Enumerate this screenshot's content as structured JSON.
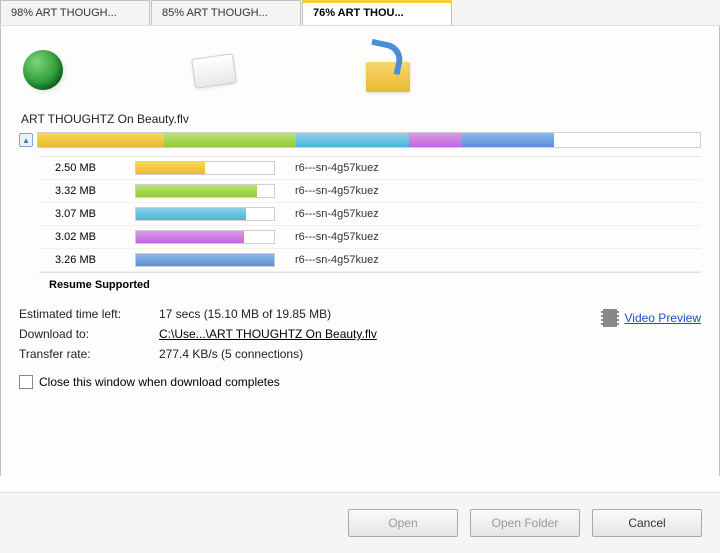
{
  "tabs": [
    {
      "label": "98% ART THOUGH..."
    },
    {
      "label": "85% ART THOUGH..."
    },
    {
      "label": "76% ART THOU..."
    }
  ],
  "active_tab": 2,
  "filename": "ART THOUGHTZ On Beauty.flv",
  "overall_segments": [
    {
      "class": "seg1",
      "width": 19
    },
    {
      "class": "seg2",
      "width": 20
    },
    {
      "class": "seg3",
      "width": 17
    },
    {
      "class": "seg4",
      "width": 8
    },
    {
      "class": "seg5",
      "width": 14
    }
  ],
  "threads": [
    {
      "size": "2.50 MB",
      "fill_class": "seg1",
      "fill_pct": 50,
      "host": "r6---sn-4g57kuez"
    },
    {
      "size": "3.32 MB",
      "fill_class": "seg2",
      "fill_pct": 88,
      "host": "r6---sn-4g57kuez"
    },
    {
      "size": "3.07 MB",
      "fill_class": "seg3",
      "fill_pct": 80,
      "host": "r6---sn-4g57kuez"
    },
    {
      "size": "3.02 MB",
      "fill_class": "seg4",
      "fill_pct": 78,
      "host": "r6---sn-4g57kuez"
    },
    {
      "size": "3.26 MB",
      "fill_class": "seg5",
      "fill_pct": 100,
      "host": "r6---sn-4g57kuez"
    }
  ],
  "resume_label": "Resume Supported",
  "info": {
    "eta_label": "Estimated time left:",
    "eta_value": "17 secs (15.10 MB of 19.85 MB)",
    "path_label": "Download to:",
    "path_value": "C:\\Use...\\ART THOUGHTZ On Beauty.flv",
    "rate_label": "Transfer rate:",
    "rate_value": "277.4 KB/s (5 connections)"
  },
  "preview_label": "Video Preview",
  "close_label": "Close this window when download completes",
  "buttons": {
    "open": "Open",
    "open_folder": "Open Folder",
    "cancel": "Cancel"
  }
}
